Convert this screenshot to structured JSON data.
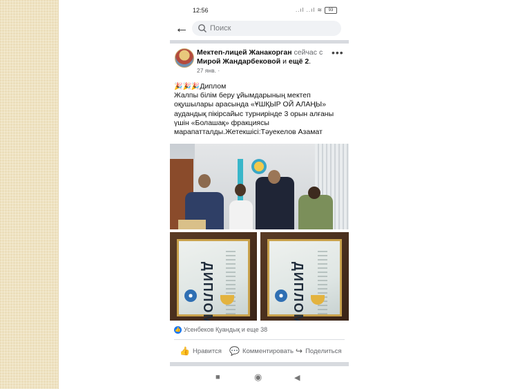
{
  "status": {
    "time": "12:56",
    "icons": "..ıl  ..ıl  ≋",
    "battery": "93"
  },
  "search": {
    "placeholder": "Поиск"
  },
  "post": {
    "author": "Мектеп-лицей Жанакорган",
    "connector_1": " сейчас с ",
    "with": "Мирой Жандарбековой",
    "connector_2": " и ",
    "more": "ещё 2",
    "end": ".",
    "date": "27 янв. ·",
    "emoji": "🎉🎉🎉",
    "text_first": "Диплом",
    "text_body": "Жалпы білім беру ұйымдарының мектеп оқушылары арасында «ҰШҚЫР ОЙ АЛАҢЫ» аудандық пікірсайыс турнирінде 3 орын алғаны үшін «Болашақ» фракциясы марапатталды.Жетекшісі:Тәуекелов Азамат",
    "cert_word": "ДИПЛОМ"
  },
  "reactions": {
    "text": "Усенбеков Қуандық и еще 38"
  },
  "actions": {
    "like": "Нравится",
    "comment": "Комментировать",
    "share": "Поделиться"
  },
  "icons": {
    "back": "←",
    "more": "•••",
    "like": "👍",
    "comment": "💬",
    "share": "↪",
    "nav_recent": "■",
    "nav_home": "◉",
    "nav_back": "◀"
  },
  "colors": {
    "accent": "#1877f2",
    "divider": "#d7dadf",
    "left_panel": "#efe3c2"
  }
}
